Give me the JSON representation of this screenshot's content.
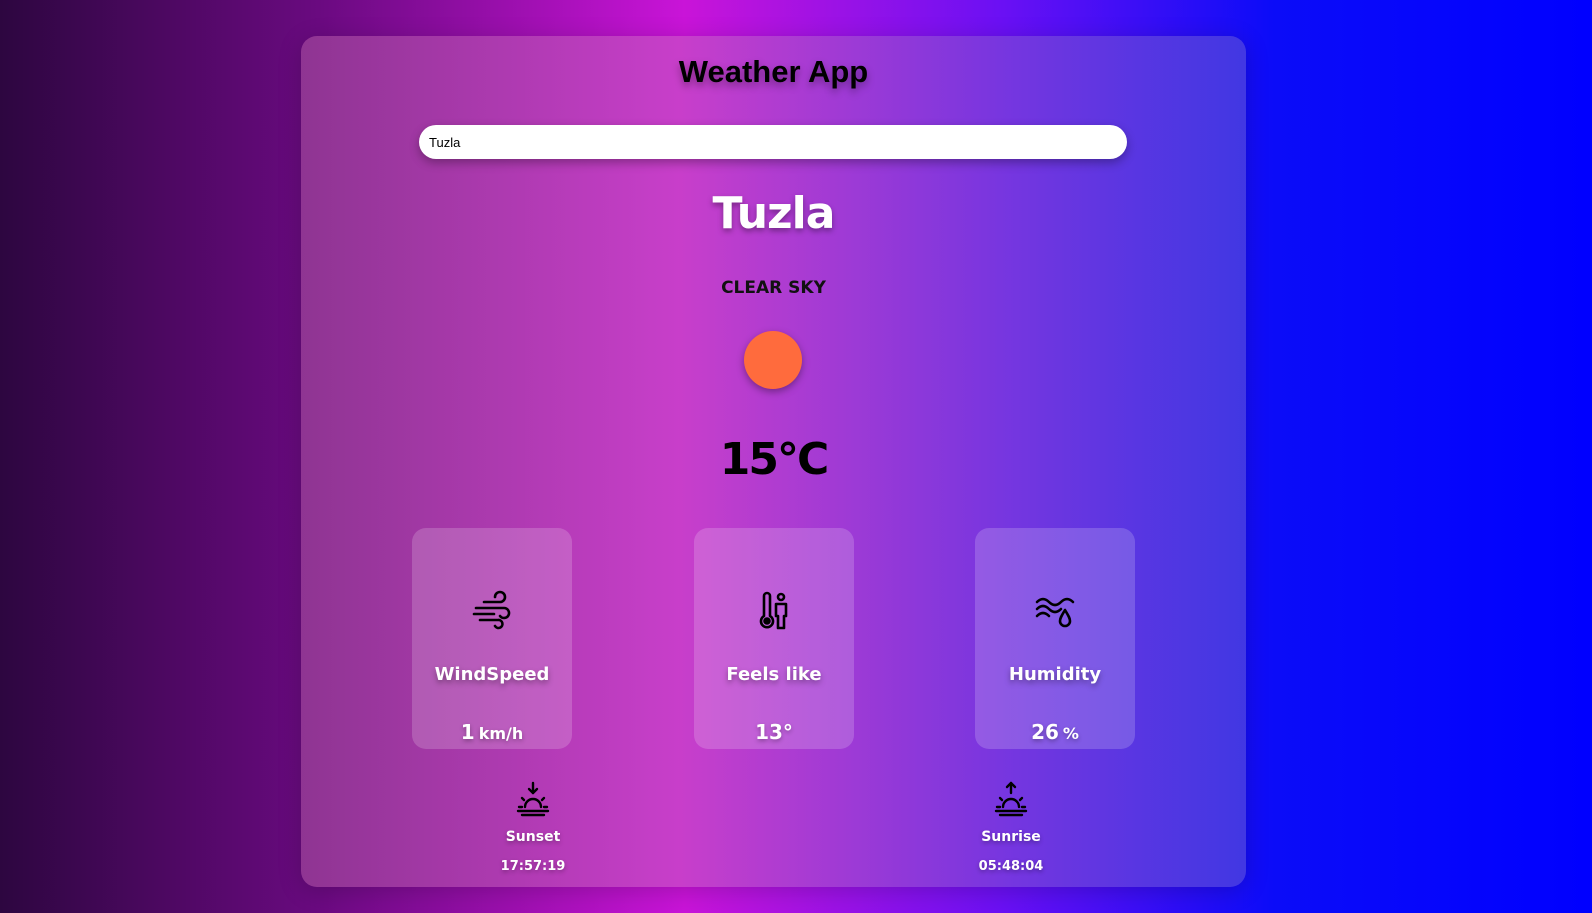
{
  "app": {
    "title": "Weather App"
  },
  "search": {
    "value": "Tuzla"
  },
  "weather": {
    "city": "Tuzla",
    "description": "CLEAR SKY",
    "condition_icon": "sun-icon",
    "sun_color": "#ff6b3d",
    "temperature": "15°C"
  },
  "details": [
    {
      "label": "WindSpeed",
      "value": "1",
      "unit": "km/h",
      "icon": "wind-icon"
    },
    {
      "label": "Feels like",
      "value": "13°",
      "unit": "",
      "icon": "thermometer-person-icon"
    },
    {
      "label": "Humidity",
      "value": "26",
      "unit": "%",
      "icon": "humidity-icon"
    }
  ],
  "sun_times": {
    "sunset": {
      "label": "Sunset",
      "time": "17:57:19",
      "icon": "sunset-icon"
    },
    "sunrise": {
      "label": "Sunrise",
      "time": "05:48:04",
      "icon": "sunrise-icon"
    }
  }
}
